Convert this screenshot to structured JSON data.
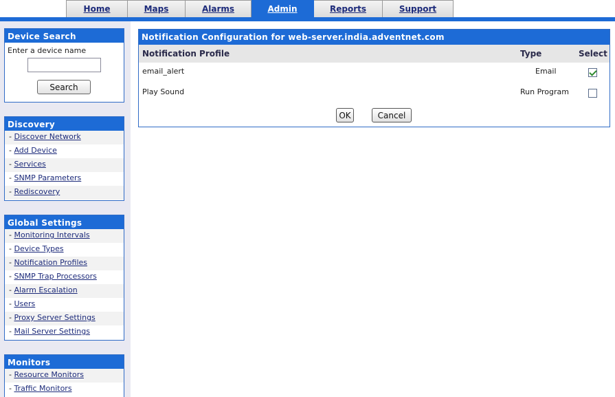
{
  "tabs": [
    {
      "label": "Home"
    },
    {
      "label": "Maps"
    },
    {
      "label": "Alarms"
    },
    {
      "label": "Admin",
      "active": true
    },
    {
      "label": "Reports"
    },
    {
      "label": "Support"
    }
  ],
  "device_search": {
    "title": "Device Search",
    "label": "Enter a device name",
    "input_value": "",
    "button_label": "Search"
  },
  "discovery": {
    "title": "Discovery",
    "items": [
      "Discover Network",
      "Add Device",
      "Services",
      "SNMP Parameters",
      "Rediscovery"
    ]
  },
  "global_settings": {
    "title": "Global Settings",
    "items": [
      "Monitoring Intervals",
      "Device Types",
      "Notification Profiles",
      "SNMP Trap Processors",
      "Alarm Escalation",
      "Users",
      "Proxy Server Settings",
      "Mail Server Settings"
    ]
  },
  "monitors": {
    "title": "Monitors",
    "items": [
      "Resource Monitors",
      "Traffic Monitors"
    ]
  },
  "notification": {
    "title": "Notification Configuration for web-server.india.adventnet.com",
    "columns": {
      "profile": "Notification Profile",
      "type": "Type",
      "select": "Select"
    },
    "rows": [
      {
        "profile": "email_alert",
        "type": "Email",
        "selected": true
      },
      {
        "profile": "Play Sound",
        "type": "Run Program",
        "selected": false
      }
    ],
    "ok_label": "OK",
    "cancel_label": "Cancel"
  },
  "colors": {
    "accent": "#1d6bd6",
    "link": "#1c2a7a",
    "sidebar_bg": "#e9e9f2"
  }
}
